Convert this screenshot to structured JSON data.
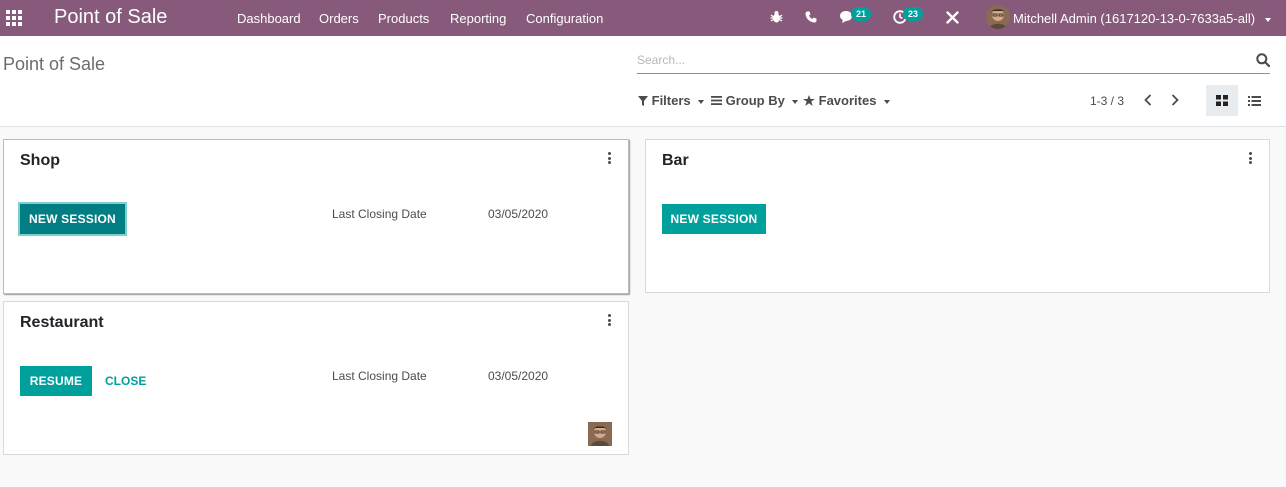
{
  "navbar": {
    "app_title": "Point of Sale",
    "menu": [
      "Dashboard",
      "Orders",
      "Products",
      "Reporting",
      "Configuration"
    ],
    "messages_count": "21",
    "activities_count": "23",
    "user_name": "Mitchell Admin (1617120-13-0-7633a5-all)",
    "icons": [
      "apps-grid-icon",
      "bug-icon",
      "phone-icon",
      "chat-icon",
      "clock-icon",
      "tools-icon"
    ]
  },
  "control_panel": {
    "breadcrumb": "Point of Sale",
    "search_placeholder": "Search...",
    "filters_label": "Filters",
    "groupby_label": "Group By",
    "favorites_label": "Favorites",
    "pager": "1-3 / 3"
  },
  "cards": [
    {
      "name": "Shop",
      "primary_action": "New Session",
      "last_closing_label": "Last Closing Date",
      "last_closing_value": "03/05/2020"
    },
    {
      "name": "Bar",
      "primary_action": "New Session"
    },
    {
      "name": "Restaurant",
      "primary_action": "Resume",
      "secondary_action": "Close",
      "last_closing_label": "Last Closing Date",
      "last_closing_value": "03/05/2020"
    }
  ],
  "colors": {
    "navbar": "#875a7b",
    "primary": "#00a09d",
    "background": "#f9f9f9"
  }
}
